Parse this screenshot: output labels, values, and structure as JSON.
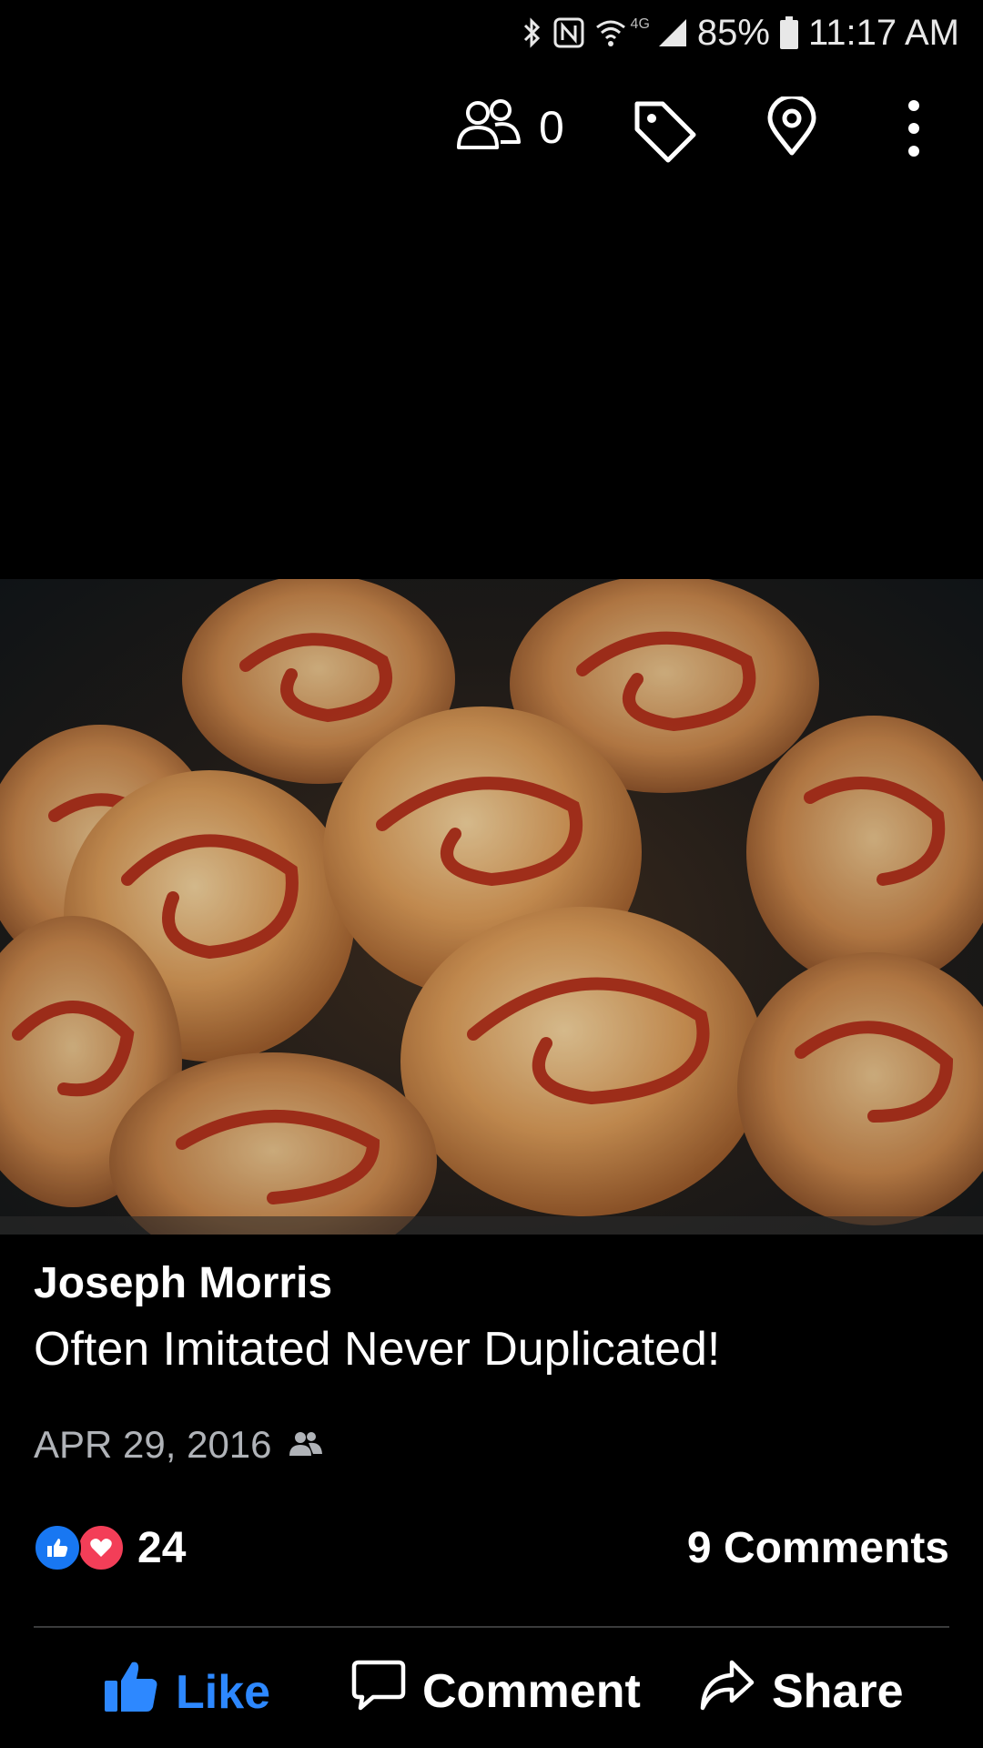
{
  "status_bar": {
    "network": "4G",
    "battery": "85%",
    "time": "11:17 AM",
    "icons": [
      "bluetooth-icon",
      "nfc-icon",
      "wifi-icon",
      "signal-icon",
      "battery-icon"
    ]
  },
  "top_bar": {
    "people_count": "0",
    "icons": [
      "people-icon",
      "tag-icon",
      "location-icon",
      "more-icon"
    ]
  },
  "photo": {
    "icon": "food-photo"
  },
  "post": {
    "author": "Joseph Morris",
    "text": "Often Imitated Never Duplicated!",
    "date": "APR 29, 2016",
    "audience_icon": "friends-icon"
  },
  "stats": {
    "reaction_count": "24",
    "comments": "9 Comments",
    "reaction_icons": [
      "like-reaction-icon",
      "love-reaction-icon"
    ]
  },
  "actions": {
    "like": "Like",
    "comment": "Comment",
    "share": "Share"
  },
  "colors": {
    "background": "#000000",
    "accent": "#2d88ff",
    "like_reaction": "#1877f2",
    "love_reaction": "#f33e58",
    "muted_text": "#b0b3b8"
  }
}
